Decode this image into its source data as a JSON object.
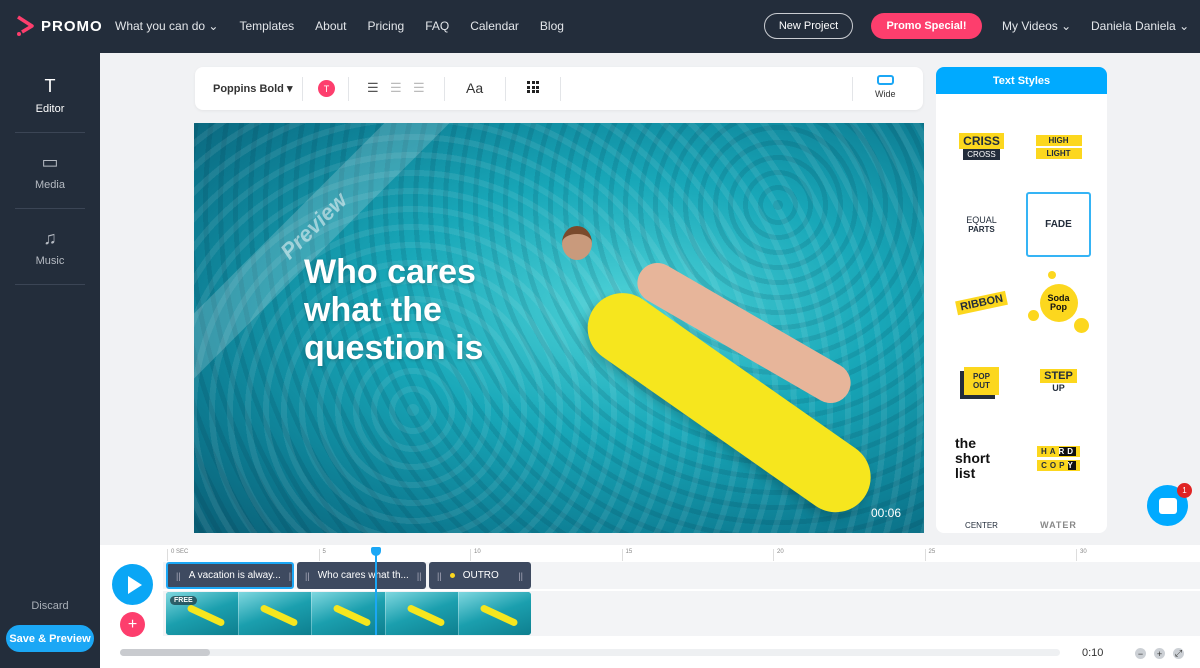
{
  "header": {
    "logo": "PROMO",
    "nav": [
      "What you can do",
      "Templates",
      "About",
      "Pricing",
      "FAQ",
      "Calendar",
      "Blog"
    ],
    "new_project": "New Project",
    "promo_special": "Promo Special!",
    "my_videos": "My Videos",
    "user": "Daniela Daniela"
  },
  "sidebar": {
    "items": [
      {
        "label": "Editor",
        "icon": "text-icon"
      },
      {
        "label": "Media",
        "icon": "media-icon"
      },
      {
        "label": "Music",
        "icon": "music-icon"
      }
    ],
    "discard": "Discard",
    "save": "Save & Preview"
  },
  "toolbar": {
    "font": "Poppins Bold",
    "color_label": "T",
    "text_size": "Aa",
    "wide": "Wide"
  },
  "video": {
    "watermark": "Preview",
    "caption": "Who cares what the question is",
    "time": "00:06"
  },
  "text_styles": {
    "title": "Text Styles",
    "styles": [
      "CRISS CROSS",
      "HIGH LIGHT",
      "EQUAL PARTS",
      "FADE",
      "RIBBON",
      "Soda Pop",
      "POP OUT",
      "STEP UP",
      "the short list",
      "HARD COPY",
      "CENTER",
      "WATER"
    ],
    "selected": "FADE"
  },
  "chat": {
    "badge": "1"
  },
  "timeline": {
    "ruler": [
      "0 SEC",
      "5",
      "10",
      "15",
      "20",
      "25",
      "30"
    ],
    "clips": [
      "A vacation is alway...",
      "Who cares what th...",
      "OUTRO"
    ],
    "free_badge": "FREE",
    "playhead_sec": 7,
    "duration": "0:10"
  },
  "colors": {
    "header": "#232d3b",
    "accent": "#1ba7f5",
    "pink": "#fd3e6d",
    "yellow": "#fcd71e"
  }
}
